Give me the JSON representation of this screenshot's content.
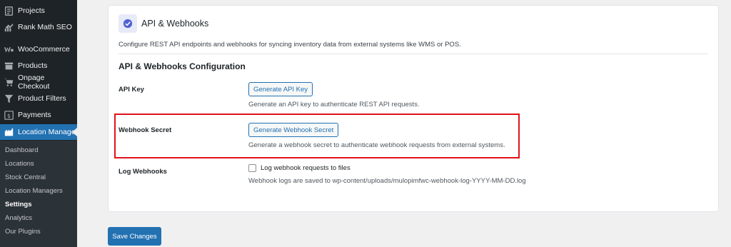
{
  "sidebar": {
    "menu": [
      {
        "label": "Projects",
        "icon": "projects-icon"
      },
      {
        "label": "Rank Math SEO",
        "icon": "rank-math-icon"
      },
      {
        "label": "WooCommerce",
        "icon": "woocommerce-icon"
      },
      {
        "label": "Products",
        "icon": "products-icon"
      },
      {
        "label": "Onpage Checkout",
        "icon": "cart-icon"
      },
      {
        "label": "Product Filters",
        "icon": "filter-icon"
      },
      {
        "label": "Payments",
        "icon": "payments-icon"
      },
      {
        "label": "Location Manage",
        "icon": "location-icon",
        "active": true
      }
    ],
    "submenu": [
      {
        "label": "Dashboard"
      },
      {
        "label": "Locations"
      },
      {
        "label": "Stock Central"
      },
      {
        "label": "Location Managers"
      },
      {
        "label": "Settings",
        "current": true
      },
      {
        "label": "Analytics"
      },
      {
        "label": "Our Plugins"
      }
    ]
  },
  "card": {
    "title": "API & Webhooks",
    "description": "Configure REST API endpoints and webhooks for syncing inventory data from external systems like WMS or POS.",
    "section_title": "API & Webhooks Configuration",
    "api_key": {
      "label": "API Key",
      "button": "Generate API Key",
      "help": "Generate an API key to authenticate REST API requests."
    },
    "webhook_secret": {
      "label": "Webhook Secret",
      "button": "Generate Webhook Secret",
      "help": "Generate a webhook secret to authenticate webhook requests from external systems."
    },
    "log_webhooks": {
      "label": "Log Webhooks",
      "checkbox_label": "Log webhook requests to files",
      "checked": false,
      "help": "Webhook logs are saved to wp-content/uploads/mulopimfwc-webhook-log-YYYY-MM-DD.log"
    }
  },
  "save_button": "Save Changes",
  "colors": {
    "sidebar_bg": "#1d2327",
    "accent": "#2271b1",
    "highlight": "#e0131a"
  }
}
